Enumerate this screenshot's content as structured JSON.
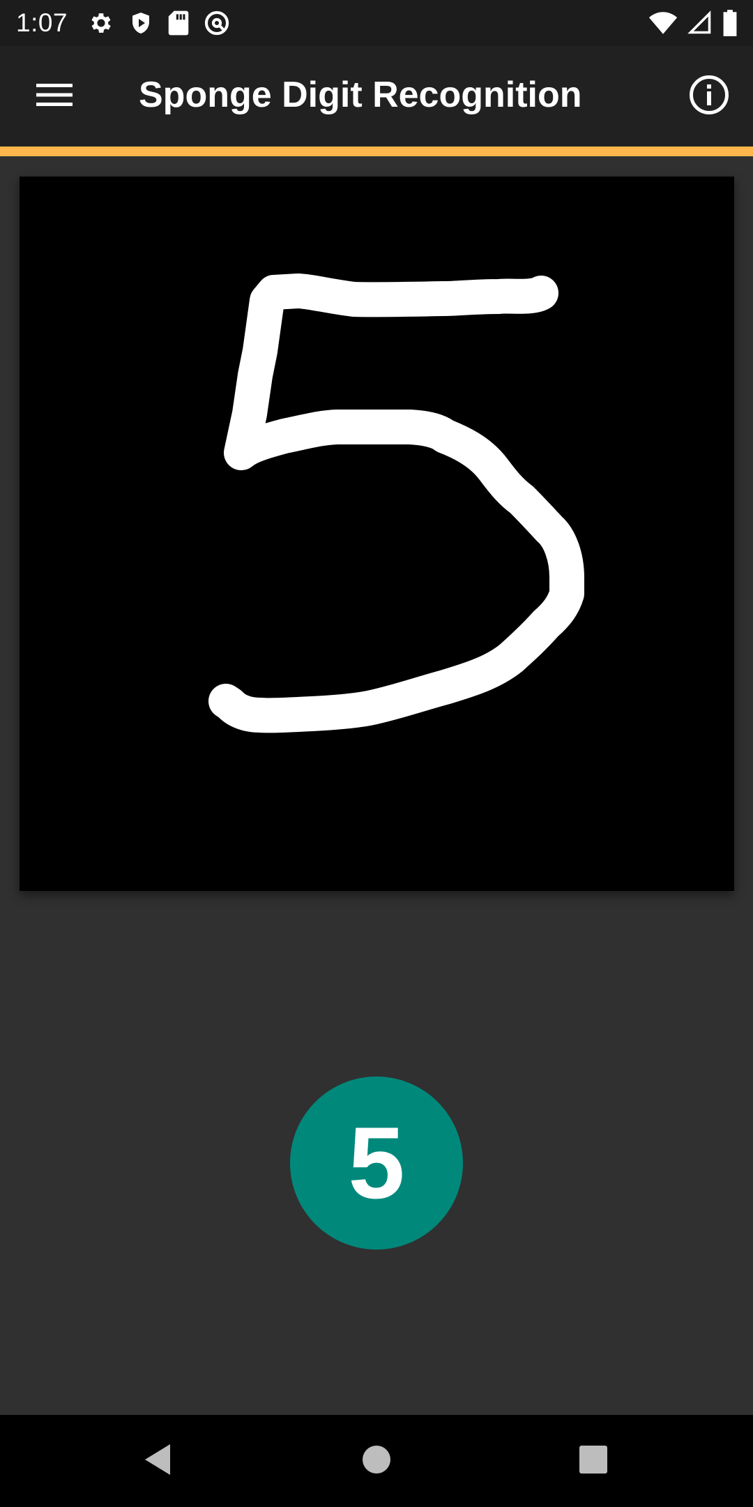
{
  "status_bar": {
    "time": "1:07",
    "left_icons": [
      "settings-icon",
      "shield-play-icon",
      "sd-card-icon",
      "at-sign-icon"
    ],
    "right_icons": [
      "wifi-icon",
      "cell-signal-icon",
      "battery-icon"
    ]
  },
  "app_bar": {
    "title": "Sponge Digit Recognition",
    "menu_icon": "hamburger-menu-icon",
    "info_icon": "info-icon",
    "accent_color": "#FFB74D",
    "background": "#212121"
  },
  "canvas": {
    "drawn_digit": "5",
    "stroke_color": "#FFFFFF",
    "background": "#000000"
  },
  "result": {
    "recognized_digit": "5",
    "circle_color": "#00897B"
  },
  "navigation": {
    "back_icon": "back-triangle-icon",
    "home_icon": "home-circle-icon",
    "recents_icon": "recents-square-icon"
  }
}
